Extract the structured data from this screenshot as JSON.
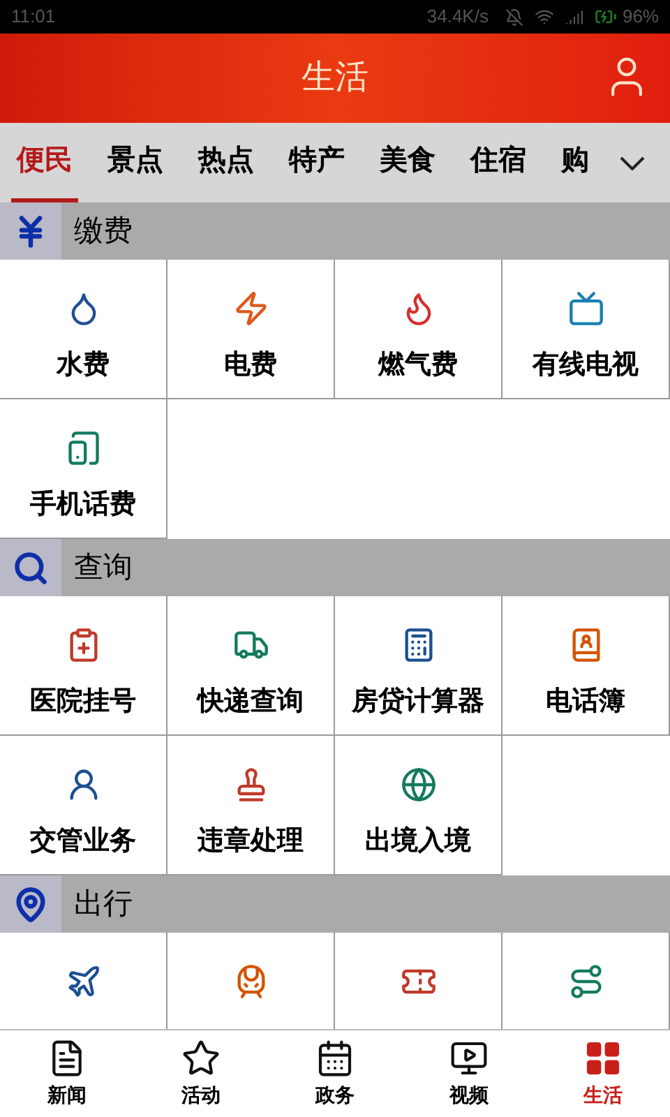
{
  "status_bar": {
    "time": "11:01",
    "speed": "34.4K/s",
    "battery": "96%"
  },
  "header": {
    "title": "生活"
  },
  "tabs": [
    {
      "label": "便民",
      "selected": true
    },
    {
      "label": "景点",
      "selected": false
    },
    {
      "label": "热点",
      "selected": false
    },
    {
      "label": "特产",
      "selected": false
    },
    {
      "label": "美食",
      "selected": false
    },
    {
      "label": "住宿",
      "selected": false
    },
    {
      "label": "购",
      "selected": false
    }
  ],
  "sections": [
    {
      "title": "缴费",
      "items": [
        {
          "kind": "labeled",
          "label": "水费"
        },
        {
          "kind": "labeled",
          "label": "电费"
        },
        {
          "kind": "labeled",
          "label": "燃气费"
        },
        {
          "kind": "labeled",
          "label": "有线电视"
        },
        {
          "kind": "labeled",
          "label": "手机话费"
        }
      ]
    },
    {
      "title": "查询",
      "items": [
        {
          "kind": "labeled",
          "label": "医院挂号"
        },
        {
          "kind": "labeled",
          "label": "快递查询"
        },
        {
          "kind": "labeled",
          "label": "房贷计算器"
        },
        {
          "kind": "labeled",
          "label": "电话簿"
        },
        {
          "kind": "labeled",
          "label": "交管业务"
        },
        {
          "kind": "labeled",
          "label": "违章处理"
        },
        {
          "kind": "labeled",
          "label": "出境入境"
        }
      ]
    },
    {
      "title": "出行",
      "items": [
        {
          "kind": "icon_only"
        },
        {
          "kind": "icon_only"
        },
        {
          "kind": "icon_only"
        },
        {
          "kind": "icon_only"
        }
      ]
    }
  ],
  "bottom_nav": [
    {
      "label": "新闻",
      "selected": false
    },
    {
      "label": "活动",
      "selected": false
    },
    {
      "label": "政务",
      "selected": false
    },
    {
      "label": "视频",
      "selected": false
    },
    {
      "label": "生活",
      "selected": true
    }
  ]
}
